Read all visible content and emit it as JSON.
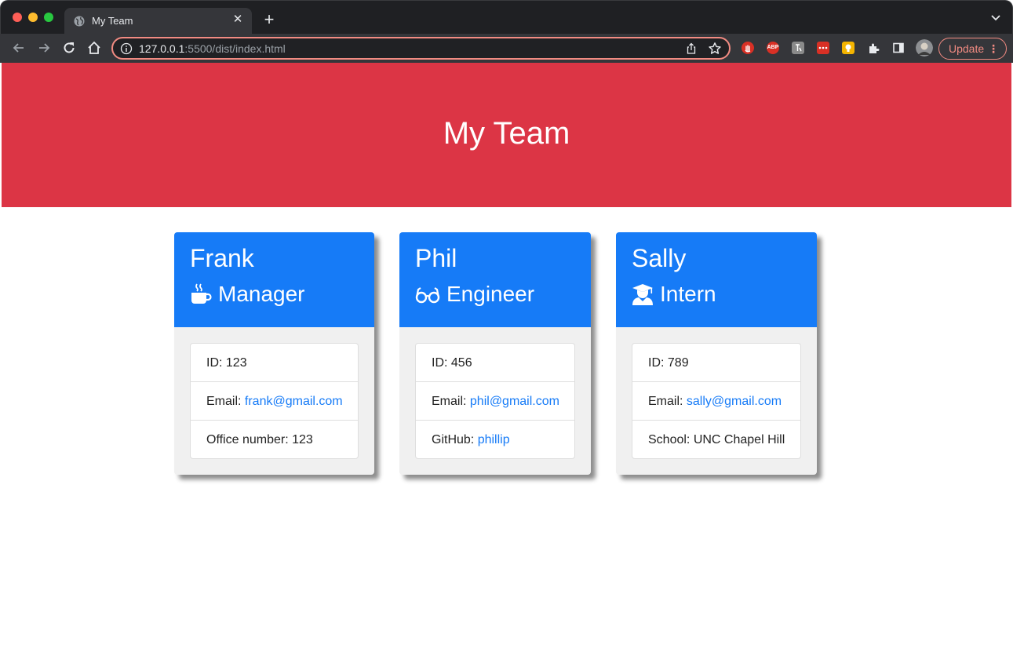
{
  "browser": {
    "tab_title": "My Team",
    "url_host": "127.0.0.1",
    "url_rest": ":5500/dist/index.html",
    "update_label": "Update",
    "extensions": [
      "stop-hand-icon",
      "adblock-plus-icon",
      "translate-icon",
      "dots-extension-icon",
      "bulb-extension-icon",
      "puzzle-extensions-icon",
      "side-panel-icon"
    ],
    "abp_label": "ABP",
    "accent_color": "#f28b82"
  },
  "header": {
    "title": "My Team",
    "background_color": "#dc3545"
  },
  "team": [
    {
      "name": "Frank",
      "role": "Manager",
      "icon": "mug-icon",
      "id_label": "ID: 123",
      "email_prefix": "Email: ",
      "email": "frank@gmail.com",
      "extra_prefix": "Office number: 123",
      "extra_link": ""
    },
    {
      "name": "Phil",
      "role": "Engineer",
      "icon": "glasses-icon",
      "id_label": "ID: 456",
      "email_prefix": "Email: ",
      "email": "phil@gmail.com",
      "extra_prefix": "GitHub: ",
      "extra_link": "phillip"
    },
    {
      "name": "Sally",
      "role": "Intern",
      "icon": "graduate-icon",
      "id_label": "ID: 789",
      "email_prefix": "Email: ",
      "email": "sally@gmail.com",
      "extra_prefix": "School: UNC Chapel Hill",
      "extra_link": ""
    }
  ],
  "colors": {
    "card_header": "#167bf7",
    "link": "#167bf7"
  }
}
